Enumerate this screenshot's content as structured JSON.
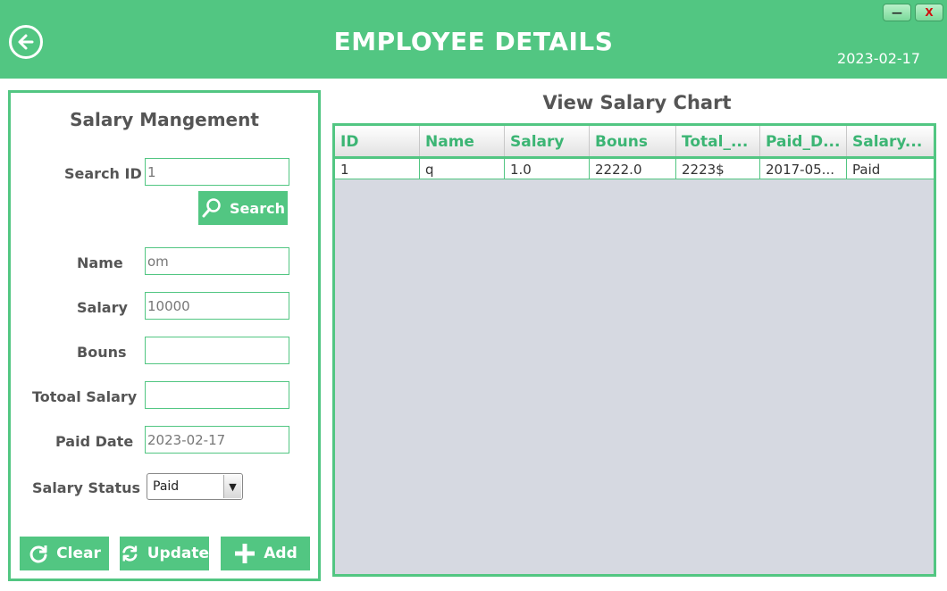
{
  "header": {
    "title": "EMPLOYEE DETAILS",
    "date": "2023-02-17",
    "minimize_label": "—",
    "close_label": "X"
  },
  "form": {
    "panel_title": "Salary Mangement",
    "search_id": {
      "label": "Search ID",
      "value": "1"
    },
    "search_button": "Search",
    "name": {
      "label": "Name",
      "value": "om"
    },
    "salary": {
      "label": "Salary",
      "value": "10000"
    },
    "bonus": {
      "label": "Bouns",
      "value": ""
    },
    "total_salary": {
      "label": "Totoal Salary",
      "value": ""
    },
    "paid_date": {
      "label": "Paid Date",
      "value": "2023-02-17"
    },
    "salary_status": {
      "label": "Salary Status",
      "value": "Paid"
    },
    "buttons": {
      "clear": "Clear",
      "update": "Update",
      "add": "Add"
    }
  },
  "table": {
    "title": "View Salary Chart",
    "columns": [
      "ID",
      "Name",
      "Salary",
      "Bouns",
      "Total_...",
      "Paid_D...",
      "Salary..."
    ],
    "rows": [
      [
        "1",
        "q",
        "1.0",
        "2222.0",
        "2223$",
        "2017-05...",
        "Paid"
      ]
    ]
  },
  "colors": {
    "accent": "#52c682",
    "table_body": "#d6d9e1",
    "header_text": "#3cb574"
  },
  "icons": {
    "back": "back-arrow-icon",
    "search": "magnifier-icon",
    "clear": "refresh-icon",
    "update": "sync-icon",
    "add": "plus-icon"
  }
}
